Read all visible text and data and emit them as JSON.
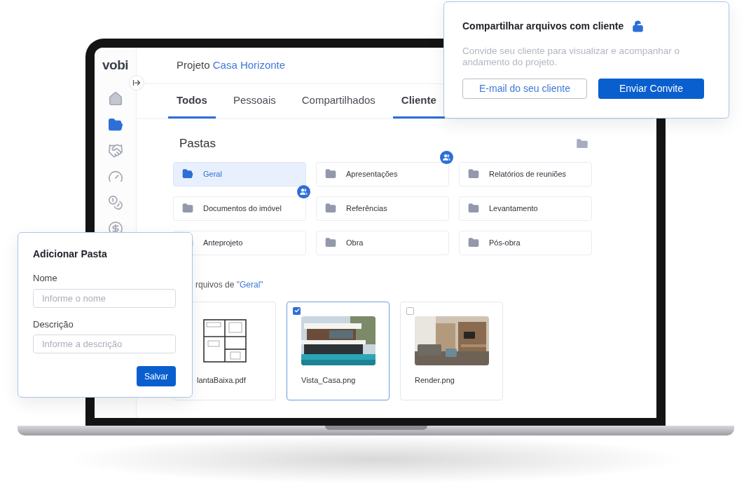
{
  "brand": "vobi",
  "sidebar": {
    "items": [
      {
        "selected": false
      },
      {
        "selected": true
      },
      {
        "selected": false
      },
      {
        "selected": false
      },
      {
        "selected": false
      },
      {
        "selected": false
      }
    ]
  },
  "header": {
    "prefix": "Projeto",
    "project": "Casa Horizonte"
  },
  "tabs": [
    {
      "label": "Todos",
      "selected": true
    },
    {
      "label": "Pessoais",
      "selected": false
    },
    {
      "label": "Compartilhados",
      "selected": false
    },
    {
      "label": "Cliente",
      "selected": true
    }
  ],
  "folders": {
    "title": "Pastas",
    "items": [
      {
        "label": "Geral",
        "selected": true,
        "shared": false
      },
      {
        "label": "Apresentações",
        "selected": false,
        "shared": true
      },
      {
        "label": "Relatórios de reuniões",
        "selected": false,
        "shared": false
      },
      {
        "label": "Documentos do imóvel",
        "selected": false,
        "shared": true
      },
      {
        "label": "Referências",
        "selected": false,
        "shared": false
      },
      {
        "label": "Levantamento",
        "selected": false,
        "shared": false
      },
      {
        "label": "Anteprojeto",
        "selected": false,
        "shared": false
      },
      {
        "label": "Obra",
        "selected": false,
        "shared": false
      },
      {
        "label": "Pós-obra",
        "selected": false,
        "shared": false
      }
    ]
  },
  "files": {
    "caption": "rquivos de",
    "folder": "\"Geral\"",
    "items": [
      {
        "name": "lantaBaixa.pdf",
        "kind": "plan"
      },
      {
        "name": "Vista_Casa.png",
        "kind": "picture",
        "checked": true
      },
      {
        "name": "Render.png",
        "kind": "picture",
        "checked": false
      }
    ]
  },
  "share_popover": {
    "title": "Compartilhar arquivos com cliente",
    "description": "Convide seu cliente para visualizar e acompanhar o andamento do projeto.",
    "email_button": "E-mail do seu cliente",
    "invite_button": "Enviar Convite"
  },
  "add_folder_popover": {
    "title": "Adicionar Pasta",
    "fields": [
      {
        "label": "Nome",
        "placeholder": "Informe o nome"
      },
      {
        "label": "Descrição",
        "placeholder": "Informe a descrição"
      }
    ],
    "save_button": "Salvar"
  }
}
